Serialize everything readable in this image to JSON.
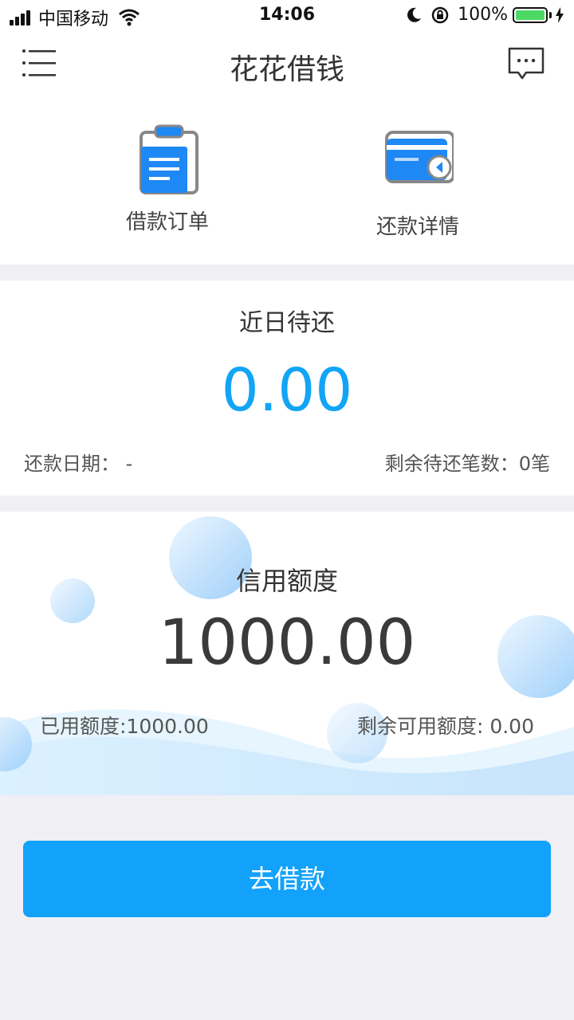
{
  "status_bar": {
    "carrier": "中国移动",
    "time": "14:06",
    "battery": "100%",
    "icons": [
      "signal-icon",
      "wifi-icon",
      "moon-icon",
      "rotation-lock-icon",
      "battery-icon",
      "charging-icon"
    ]
  },
  "nav": {
    "title": "花花借钱",
    "menu_icon": "menu-icon",
    "message_icon": "message-icon"
  },
  "quick_actions": [
    {
      "label": "借款订单",
      "icon": "clipboard-icon"
    },
    {
      "label": "还款详情",
      "icon": "card-return-icon"
    }
  ],
  "due": {
    "title": "近日待还",
    "amount": "0.00",
    "date_label": "还款日期：  -",
    "count_label": "剩余待还笔数：0笔"
  },
  "credit": {
    "title": "信用额度",
    "amount": "1000.00",
    "used_label": "已用额度:1000.00",
    "remaining_label": "剩余可用额度: 0.00"
  },
  "action": {
    "borrow_label": "去借款"
  },
  "colors": {
    "accent": "#12a2fb",
    "amount_blue": "#12a5f5",
    "page_bg": "#efeff4"
  }
}
